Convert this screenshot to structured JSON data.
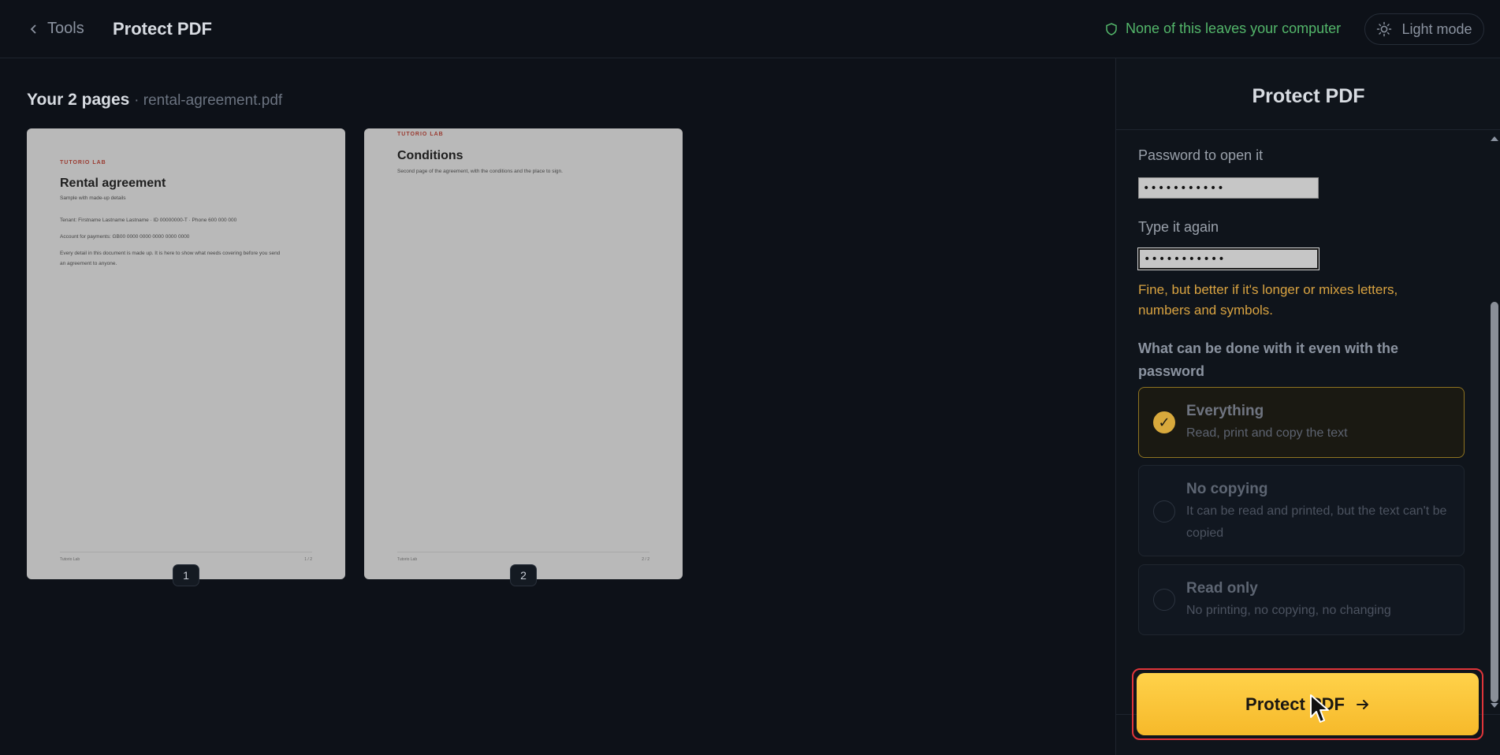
{
  "header": {
    "back_label": "Tools",
    "title": "Protect PDF",
    "privacy_note": "None of this leaves your computer",
    "theme_toggle": "Light mode",
    "accent_green": "#53b66a"
  },
  "main": {
    "heading_bold": "Your 2 pages",
    "heading_file": "· rental-agreement.pdf",
    "pages": [
      {
        "number": "1",
        "brand": "TUTORIO LAB",
        "title": "Rental agreement",
        "lines": [
          "Sample with made-up details",
          "Tenant: Firstname Lastname Lastname · ID 00000000-T · Phone 600 000 000",
          "Account for payments: GB00 0000 0000 0000 0000 0000",
          "Every detail in this document is made up. It is here to show what needs covering before you send",
          "an agreement to anyone."
        ],
        "footer_left": "Tutorio Lab",
        "footer_right": "1 / 2"
      },
      {
        "number": "2",
        "brand": "TUTORIO LAB",
        "title": "Conditions",
        "lines": [
          "Second page of the agreement, with the conditions and the place to sign."
        ],
        "footer_left": "Tutorio Lab",
        "footer_right": "2 / 2"
      }
    ]
  },
  "panel": {
    "title": "Protect PDF",
    "password_label": "Password to open it",
    "password_value": "•••••••••••",
    "confirm_label": "Type it again",
    "confirm_value": "•••••••••••",
    "strength_warning": "Fine, but better if it's longer or mixes letters, numbers and symbols.",
    "permissions_heading": "What can be done with it even with the password",
    "options": [
      {
        "title": "Everything",
        "desc": "Read, print and copy the text",
        "selected": true
      },
      {
        "title": "No copying",
        "desc": "It can be read and printed, but the text can't be copied",
        "selected": false
      },
      {
        "title": "Read only",
        "desc": "No printing, no copying, no changing",
        "selected": false
      }
    ],
    "check_glyph": "✓",
    "cta_label": "Protect PDF",
    "accent_yellow": "#f6b92a",
    "warning_color": "#d9a341"
  }
}
